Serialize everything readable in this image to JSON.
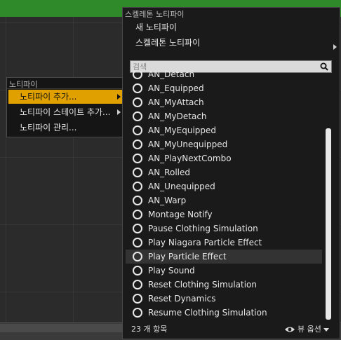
{
  "menu1": {
    "header": "노티파이",
    "items": [
      {
        "label": "노티파이 추가...",
        "submenu": true,
        "active": true
      },
      {
        "label": "노티파이 스테이트 추가...",
        "submenu": true,
        "active": false
      },
      {
        "label": "노티파이 관리...",
        "submenu": false,
        "active": false
      }
    ]
  },
  "menu2": {
    "header": "스켈레톤 노티파이",
    "items": [
      {
        "label": "새 노티파이",
        "submenu": false
      },
      {
        "label": "스켈레톤 노티파이",
        "submenu": true
      }
    ],
    "search": {
      "placeholder": "검색"
    },
    "list": [
      "AN_Detach",
      "AN_Equipped",
      "AN_MyAttach",
      "AN_MyDetach",
      "AN_MyEquipped",
      "AN_MyUnequipped",
      "AN_PlayNextCombo",
      "AN_Rolled",
      "AN_Unequipped",
      "AN_Warp",
      "Montage Notify",
      "Pause Clothing Simulation",
      "Play Niagara Particle Effect",
      "Play Particle Effect",
      "Play Sound",
      "Reset Clothing Simulation",
      "Reset Dynamics",
      "Resume Clothing Simulation"
    ],
    "highlighted": "Play Particle Effect",
    "footer": {
      "count": "23 개 항목",
      "view_options": "뷰 옵션"
    }
  },
  "colors": {
    "accent": "#e0a000",
    "background": "#2b2b2b",
    "menu_bg": "#1a1a1a"
  }
}
